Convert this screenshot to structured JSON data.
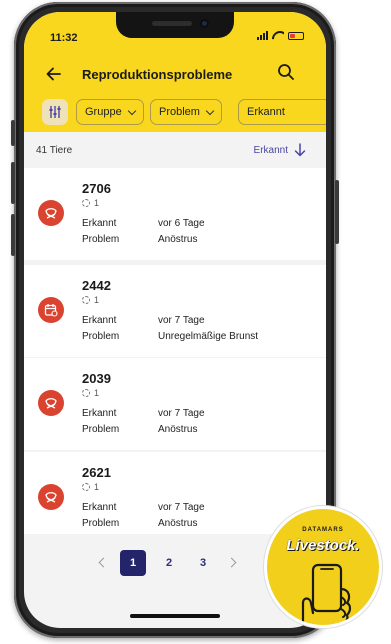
{
  "status": {
    "time": "11:32"
  },
  "appbar": {
    "title": "Reproduktionsprobleme"
  },
  "filters": {
    "chips": [
      "Gruppe",
      "Problem",
      "Erkannt"
    ]
  },
  "list": {
    "count": "41 Tiere",
    "sort_label": "Erkannt"
  },
  "cards": [
    {
      "id": "2706",
      "sub": "1",
      "k1": "Erkannt",
      "v1": "vor 6 Tage",
      "k2": "Problem",
      "v2": "Anöstrus",
      "icon": "cow-icon"
    },
    {
      "id": "2442",
      "sub": "1",
      "k1": "Erkannt",
      "v1": "vor 7 Tage",
      "k2": "Problem",
      "v2": "Unregelmäßige Brunst",
      "icon": "calendar-icon"
    },
    {
      "id": "2039",
      "sub": "1",
      "k1": "Erkannt",
      "v1": "vor 7 Tage",
      "k2": "Problem",
      "v2": "Anöstrus",
      "icon": "cow-icon"
    },
    {
      "id": "2621",
      "sub": "1",
      "k1": "Erkannt",
      "v1": "vor 7 Tage",
      "k2": "Problem",
      "v2": "Anöstrus",
      "icon": "cow-icon"
    }
  ],
  "pagination": {
    "pages": [
      "1",
      "2",
      "3"
    ],
    "current": "1"
  },
  "badge": {
    "brand": "DATAMARS",
    "product": "Livestock."
  },
  "colors": {
    "accent": "#f9d71e",
    "primary": "#24246b",
    "alert": "#d9432f"
  }
}
